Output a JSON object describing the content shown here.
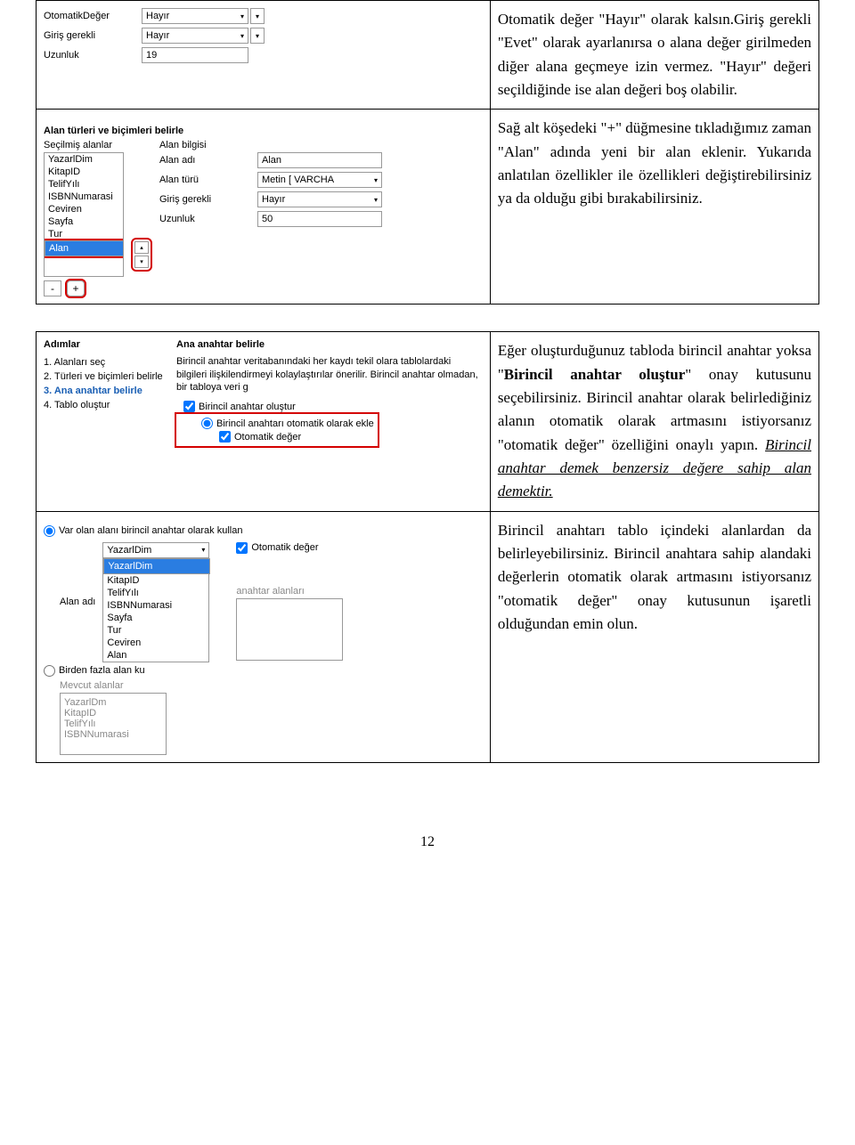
{
  "section1": {
    "top_form": {
      "fields": [
        {
          "label": "OtomatikDeğer",
          "value": "Hayır",
          "type": "select"
        },
        {
          "label": "Giriş gerekli",
          "value": "Hayır",
          "type": "select"
        },
        {
          "label": "Uzunluk",
          "value": "19",
          "type": "text"
        }
      ]
    },
    "section_title": "Alan türleri ve biçimleri belirle",
    "selected_fields_label": "Seçilmiş alanlar",
    "field_info_label": "Alan bilgisi",
    "selected_fields": [
      "YazarlDim",
      "KitapID",
      "TelifYılı",
      "ISBNNumarasi",
      "Ceviren",
      "Sayfa",
      "Tur",
      "Alan"
    ],
    "selected_index": 7,
    "info_fields": [
      {
        "label": "Alan adı",
        "value": "Alan",
        "type": "text"
      },
      {
        "label": "Alan türü",
        "value": "Metin [ VARCHA",
        "type": "select"
      },
      {
        "label": "Giriş gerekli",
        "value": "Hayır",
        "type": "select"
      },
      {
        "label": "Uzunluk",
        "value": "50",
        "type": "text"
      }
    ],
    "minus_btn": "-",
    "plus_btn": "+",
    "up_btn": "^",
    "down_btn": "v",
    "desc1": "Otomatik değer \"Hayır\" olarak kalsın.Giriş gerekli \"Evet\" olarak ayarlanırsa o alana değer girilmeden diğer alana geçmeye izin vermez. \"Hayır\" değeri seçildiğinde ise alan değeri boş olabilir.",
    "desc2": "Sağ alt köşedeki \"+\" düğmesine tıkladığımız zaman \"Alan\" adında yeni bir alan eklenir. Yukarıda anlatılan özellikler ile özellikleri değiştirebilirsiniz ya da olduğu gibi bırakabilirsiniz."
  },
  "section2": {
    "steps_title": "Adımlar",
    "steps": [
      "1. Alanları seç",
      "2. Türleri ve biçimleri belirle",
      "3. Ana anahtar belirle",
      "4. Tablo oluştur"
    ],
    "active_step": 2,
    "pk_title": "Ana anahtar belirle",
    "pk_intro": "Birincil anahtar veritabanındaki her kaydı tekil olara tablolardaki bilgileri ilişkilendirmeyi kolaylaştırılar önerilir. Birincil anahtar olmadan, bir tabloya veri g",
    "cb_create_pk": "Birincil anahtar oluştur",
    "radio_auto_add": "Birincil anahtarı otomatik olarak ekle",
    "cb_auto_value": "Otomatik değer",
    "radio_use_existing": "Var olan alanı birincil anahtar olarak kullan",
    "radio_multi": "Birden fazla alan ku",
    "lbl_alan_adi": "Alan adı",
    "lbl_mevcut": "Mevcut alanlar",
    "lbl_anahtar_alanlari": "anahtar alanları",
    "cb_auto_value2": "Otomatik değer",
    "dd_value": "YazarlDim",
    "dd_options": [
      "YazarlDim",
      "KitapID",
      "TelifYılı",
      "ISBNNumarasi",
      "Sayfa",
      "Tur",
      "Ceviren",
      "Alan"
    ],
    "dd_selected": 0,
    "mevcut_list": [
      "YazarlDm",
      "KitapID",
      "TelifYılı",
      "ISBNNumarasi"
    ],
    "desc1_pre": "Eğer oluşturduğunuz tabloda birincil anahtar yoksa \"",
    "desc1_b1": "Birincil anahtar oluştur",
    "desc1_mid": "\" onay kutusunu seçebilirsiniz. Birincil anahtar olarak belirlediğiniz alanın otomatik olarak artmasını istiyorsanız \"otomatik değer\" özelliğini onaylı yapın. ",
    "desc1_ital": "Birincil anahtar demek benzersiz değere sahip alan demektir.",
    "desc2": "Birincil anahtarı tablo içindeki alanlardan da belirleyebilirsiniz. Birincil anahtara sahip alandaki değerlerin otomatik olarak artmasını istiyorsanız \"otomatik değer\" onay kutusunun işaretli olduğundan emin olun."
  },
  "page_number": "12"
}
